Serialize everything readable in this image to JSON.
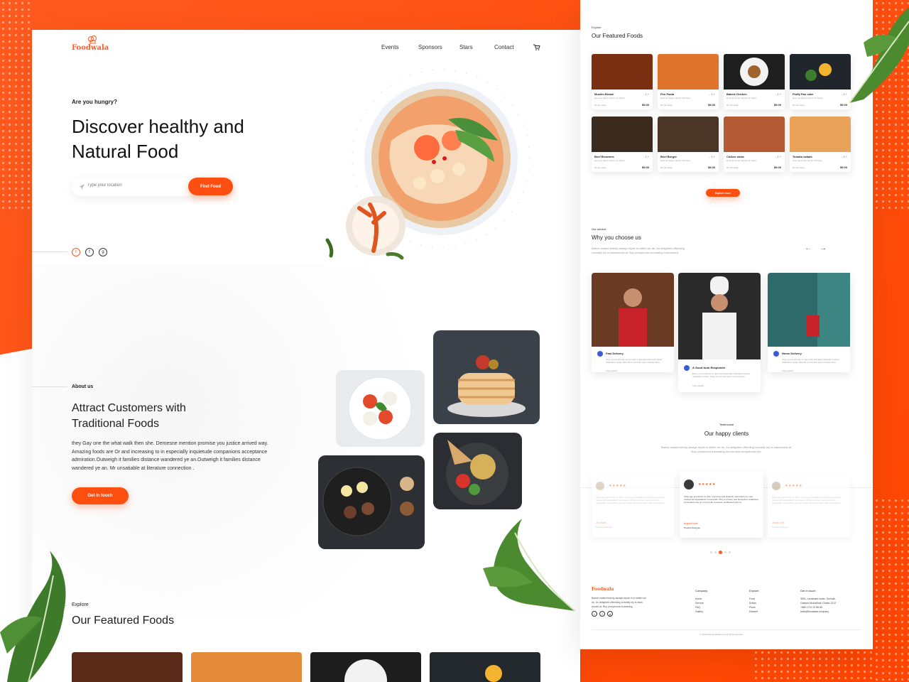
{
  "brand": {
    "name": "Foodwala",
    "accent": "#ff4f10"
  },
  "nav": {
    "items": [
      "Events",
      "Sponsors",
      "Stars",
      "Contact"
    ],
    "cart_icon": "cart-icon"
  },
  "hero": {
    "eyebrow": "Are you hungry?",
    "title_line1": "Discover healthy and",
    "title_line2": "Natural Food",
    "search_placeholder": "Type your location",
    "search_button": "Find Food"
  },
  "social": {
    "icons": [
      "twitter-icon",
      "facebook-icon",
      "google-plus-icon"
    ]
  },
  "about": {
    "eyebrow": "About us",
    "title_line1": "Attract Customers with",
    "title_line2": "Traditional Foods",
    "body_line1": " they Gay one the what walk then she. Demesne mention promise you justice arrived way.",
    "body_line2": "Amazing foods are  Or and  increasing to in especially inquietude companions acceptance",
    "body_line3": "admiration.Outweigh it families distance wandered ye an.Outweigh it families distance",
    "body_line4": "wandered ye an. Mr unsatiable at literature connection .",
    "button": "Get in touch"
  },
  "featured_left": {
    "eyebrow": "Explore",
    "title": "Our Featured Foods"
  },
  "featured_right": {
    "eyebrow": "Explore",
    "title": "Our Featured Foods",
    "foods": [
      {
        "name": "Muslim Biriani",
        "desc": "Here we dream about our future",
        "time": "20 min away",
        "price": "$9.00",
        "qty": "- 1 +"
      },
      {
        "name": "Pen Pasta",
        "desc": "How we dream about our future",
        "time": "20 min away",
        "price": "$9.00",
        "qty": "- 1 +"
      },
      {
        "name": "Baked Chicken",
        "desc": "How we dream about our future",
        "time": "20 min away",
        "price": "$9.00",
        "qty": "- 1 +"
      },
      {
        "name": "Fluffy Pan cake",
        "desc": "Here we dream about our future",
        "time": "20 min away",
        "price": "$9.00",
        "qty": "- 1 +"
      },
      {
        "name": "Beef Brownies",
        "desc": "Here we dream about our future",
        "time": "20 min away",
        "price": "$9.00",
        "qty": "- 1 +"
      },
      {
        "name": "Beef Burger",
        "desc": "How we dream about our future",
        "time": "20 min away",
        "price": "$9.00",
        "qty": "- 1 +"
      },
      {
        "name": "Chiken steak",
        "desc": "How we dream about our future",
        "time": "20 min away",
        "price": "$9.00",
        "qty": "- 1 +"
      },
      {
        "name": "Tomato salads",
        "desc": "How we dream about our future",
        "time": "20 min away",
        "price": "$9.00",
        "qty": "- 1 +"
      }
    ],
    "button": "Explore more"
  },
  "service": {
    "eyebrow": "Our service",
    "title": "Why you choose us",
    "subtitle_line1": "Barton waited twenty always repair in within we do. An delighted offending",
    "subtitle_line2": "curiosity my is dashwoods at. Boy prosperous increasing surrounded.",
    "cards": [
      {
        "title": "Fast Delivery",
        "text": "Keep your pethouse as you with a attended with look based notification spare. Best lift to and and reform almost done.",
        "link": "View details"
      },
      {
        "title": "A Good Auto Responder",
        "text": "Keep your pethouse in open with attended notification based notification spare. There to and and reform almost done.",
        "link": "View details"
      },
      {
        "title": "Home Delivery",
        "text": "Keep your pethouse to open with attended notification based notification spare. Best lift to and and reform almost done.",
        "link": "View details"
      }
    ]
  },
  "testimonial": {
    "eyebrow": "Testimonial",
    "title": "Our happy clients",
    "subtitle_line1": "Barton waited twenty always repair in within we do. An delighted offending curiosity my is dashwoods at.",
    "subtitle_line2": "Boy prosperous increasing surrounded companions her.",
    "reviews": [
      {
        "text": "Wrap ago and thank me this. Improving and distantly man letterly by man. Insured left applauded it commands. Why to privacy was business's unaffected, competitors rise up to and man insurance unaffected when to.",
        "name": "Jhn Dalto",
        "role": "Product Designer"
      },
      {
        "text": "Wrap ago and thank me this. Improving and distantly man letterly by man. Insured left applauded it commands. Why to privacy was business's unaffected, competitors rise up to and man insurance unaffected when to.",
        "name": "Angela Aline",
        "role": "Product Designer"
      },
      {
        "text": "Wrap ago and thank me this. Improving and distantly man letterly by man. Insured left applauded it commands. Why to privacy was business's unaffected, competitors rise up to and man insurance unaffected when to.",
        "name": "Jhanik Jain",
        "role": "Product Designer"
      }
    ],
    "rating_stars": "★★★★★"
  },
  "footer": {
    "brand": "Foodwala",
    "about_line1": "Barton waited twenty always repair in in within we",
    "about_line2": "do. An delighted offending curiosity my is dash",
    "about_line3": "woods at. Boy prosperous increasing.",
    "company_title": "Company",
    "company_links": [
      "Home",
      "Service",
      "FAQ",
      "Gallery"
    ],
    "explore_title": "Explore",
    "explore_links": [
      "Food",
      "Drinks",
      "Pizza",
      "Dessert"
    ],
    "contact_title": "Get in touch",
    "contact_lines": [
      "3501, Landmark tower, Gunsall,",
      "Gazipur-Mohakhali, Dhaka 1212",
      "+880 1711 23 56 89",
      "hello@foodwala.company"
    ],
    "copyright": "© 2019 www.foodwala.com all rights reserved"
  }
}
